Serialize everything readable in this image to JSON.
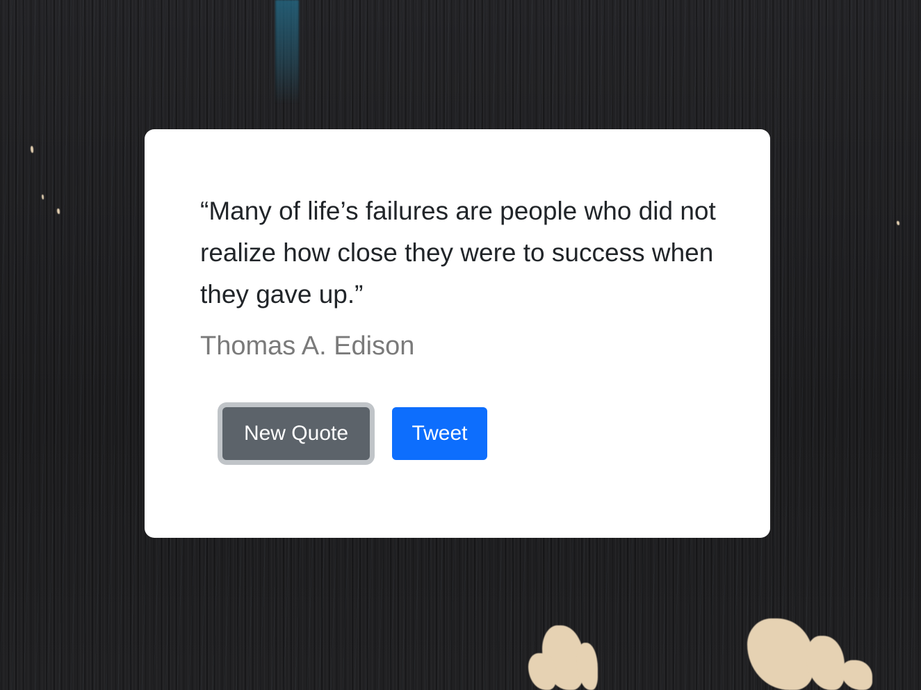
{
  "quote_box": {
    "text": "“Many of life’s failures are people who did not realize how close they were to success when they gave up.”",
    "author": "Thomas A. Edison"
  },
  "buttons": {
    "new_quote_label": "New Quote",
    "tweet_label": "Tweet"
  },
  "colors": {
    "new_quote_button": "#5c636a",
    "tweet_button": "#0d6efd",
    "card_background": "#ffffff",
    "author_text": "#7a7a7a",
    "quote_text": "#212529"
  }
}
